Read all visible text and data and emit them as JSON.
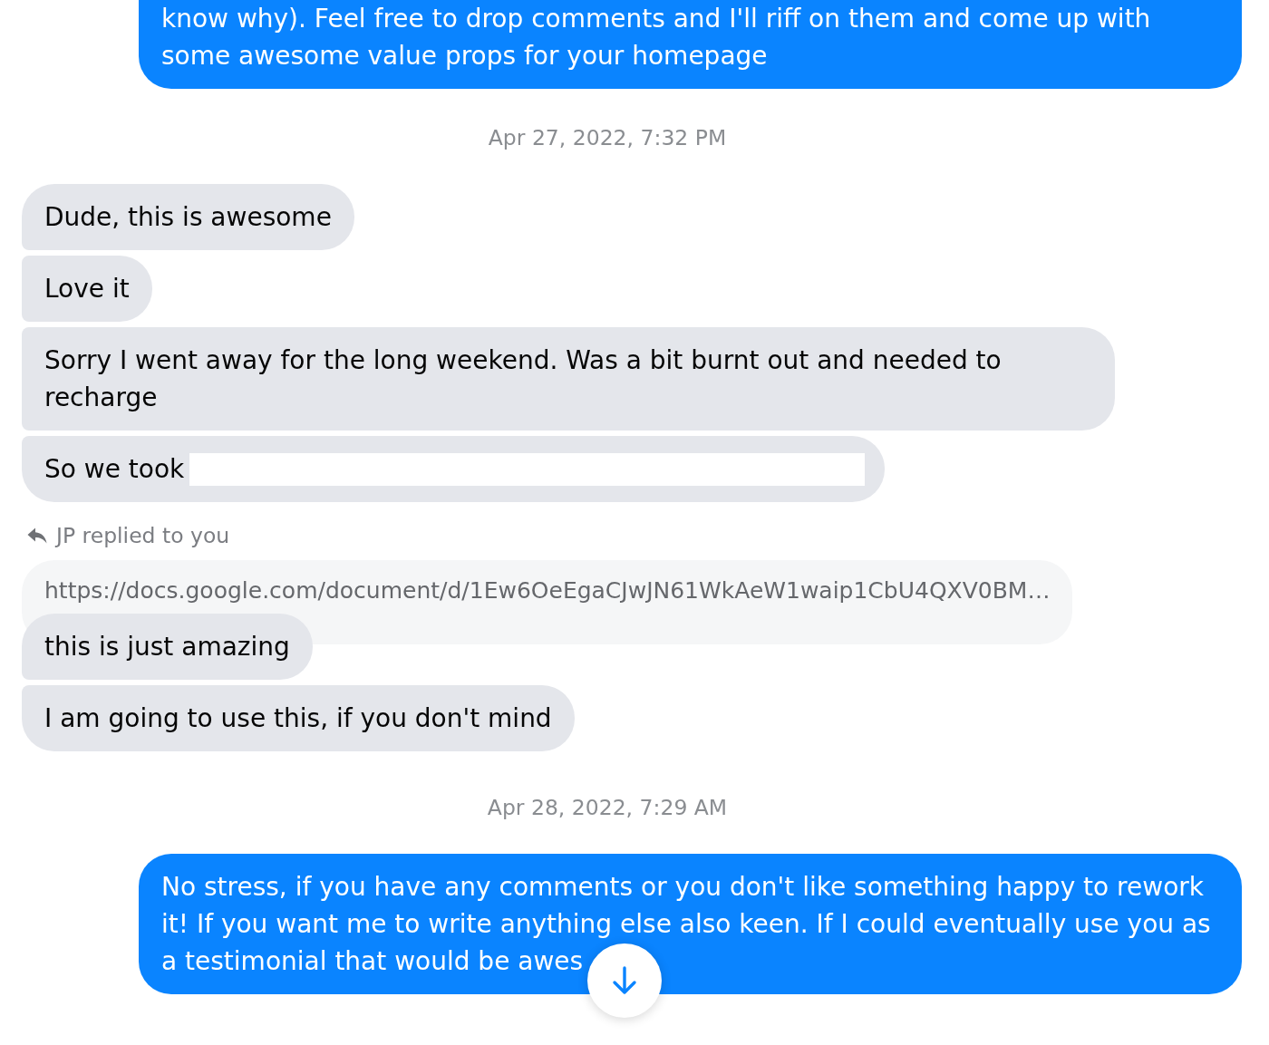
{
  "thread": [
    {
      "kind": "outgoing",
      "bubbles": [
        {
          "text": "know why). Feel free to drop comments and I'll riff on them and come up with some awesome value props for your homepage",
          "redacted": false
        }
      ]
    },
    {
      "kind": "timestamp",
      "text": "Apr 27, 2022, 7:32 PM"
    },
    {
      "kind": "incoming",
      "bubbles": [
        {
          "text": "Dude, this is awesome",
          "redacted": false
        },
        {
          "text": "Love it",
          "redacted": false
        },
        {
          "text": "Sorry I went away for the long weekend. Was a bit burnt out and needed to recharge",
          "redacted": false
        },
        {
          "text": "So we took",
          "redacted": true
        }
      ]
    },
    {
      "kind": "reply",
      "label": "JP replied to you",
      "quote": "https://docs.google.com/document/d/1Ew6OeEgaCJwJN61WkAeW1waip1CbU4QXV0BM…",
      "bubbles": [
        {
          "text": "this is just amazing",
          "redacted": false
        },
        {
          "text": "I am going to use this, if you don't mind",
          "redacted": false
        }
      ]
    },
    {
      "kind": "timestamp",
      "text": "Apr 28, 2022, 7:29 AM"
    },
    {
      "kind": "outgoing",
      "bubbles": [
        {
          "text": "No stress, if you have any comments or you don't like something happy to rework it! If you want me to write anything else also keen. If I could eventually use you as a testimonial that would be awes",
          "redacted": false
        }
      ]
    }
  ]
}
